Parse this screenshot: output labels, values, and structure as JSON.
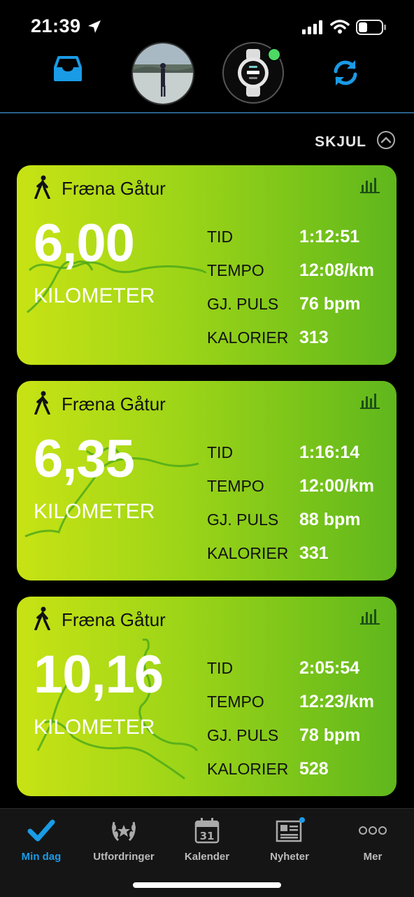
{
  "status_bar": {
    "time": "21:39"
  },
  "hide_row": {
    "label": "SKJUL"
  },
  "stat_labels": {
    "tid": "TID",
    "tempo": "TEMPO",
    "puls": "GJ. PULS",
    "kalorier": "KALORIER"
  },
  "cards": [
    {
      "title": "Fræna Gåtur",
      "distance": "6,00",
      "unit": "KILOMETER",
      "tid": "1:12:51",
      "tempo": "12:08/km",
      "puls": "76 bpm",
      "kalorier": "313"
    },
    {
      "title": "Fræna Gåtur",
      "distance": "6,35",
      "unit": "KILOMETER",
      "tid": "1:16:14",
      "tempo": "12:00/km",
      "puls": "88 bpm",
      "kalorier": "331"
    },
    {
      "title": "Fræna Gåtur",
      "distance": "10,16",
      "unit": "KILOMETER",
      "tid": "2:05:54",
      "tempo": "12:23/km",
      "puls": "78 bpm",
      "kalorier": "528"
    }
  ],
  "nav": [
    {
      "label": "Min dag",
      "icon": "checkmark-icon",
      "active": true
    },
    {
      "label": "Utfordringer",
      "icon": "laurel-icon"
    },
    {
      "label": "Kalender",
      "icon": "calendar-icon",
      "day": "31"
    },
    {
      "label": "Nyheter",
      "icon": "newspaper-icon"
    },
    {
      "label": "Mer",
      "icon": "more-icon"
    }
  ],
  "colors": {
    "accent": "#1a9be6",
    "card_start": "#c8e314",
    "card_end": "#5fb71c",
    "online": "#4cd964"
  }
}
